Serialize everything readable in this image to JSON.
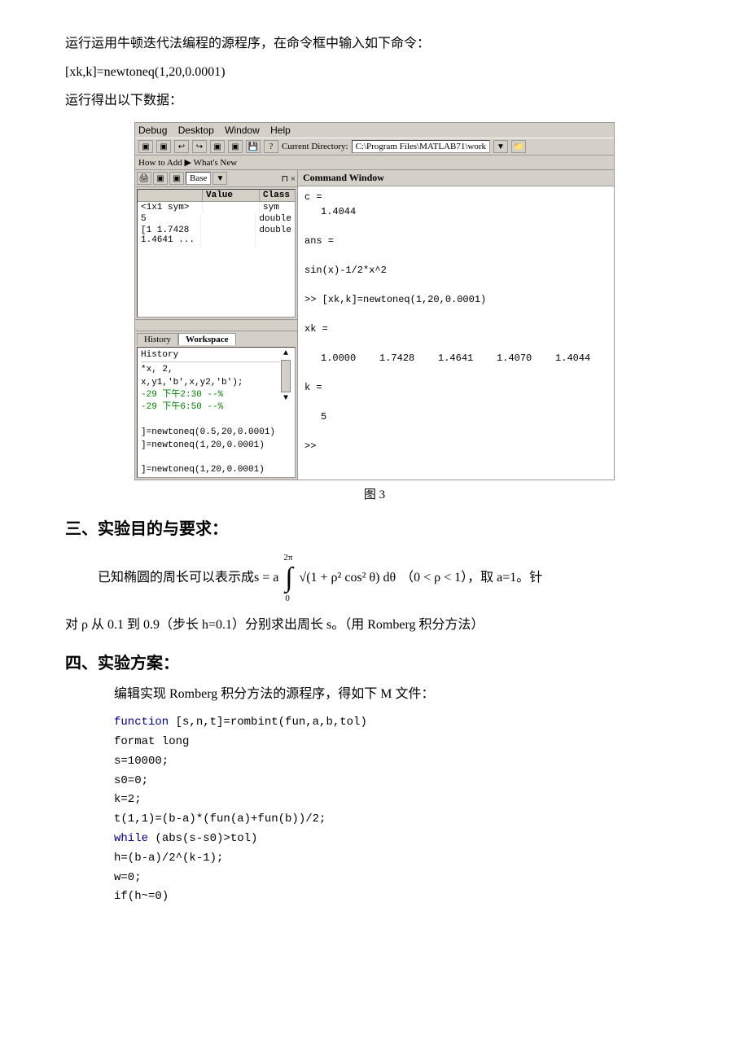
{
  "intro": {
    "line1": "运行运用牛顿迭代法编程的源程序，在命令框中输入如下命令：",
    "line2": "[xk,k]=newtoneq(1,20,0.0001)",
    "line3": "运行得出以下数据："
  },
  "matlab": {
    "menu": [
      "Debug",
      "Desktop",
      "Window",
      "Help"
    ],
    "current_dir_label": "Current Directory:",
    "current_dir_path": "C:\\Program Files\\MATLAB71\\work",
    "howtoadd": "How to Add",
    "whats_new": "What's New",
    "workspace_tab": "Workspace",
    "history_tab": "History",
    "workspace_cols": [
      "",
      "Value",
      "Class"
    ],
    "workspace_rows": [
      {
        "name": "<1x1 sym>",
        "value": "",
        "class": "sym"
      },
      {
        "name": "5",
        "value": "",
        "class": "double"
      },
      {
        "name": "[1 1.7428 1.4641 ...",
        "value": "",
        "class": "double"
      }
    ],
    "history_lines": [
      "*x, 2,",
      "x,y1,'b',x,y2,'b');",
      "-29 下午2:30 --%",
      "-29 下午6:50 --%",
      "",
      "]=newtoneq(0.5,20,0.0001)",
      "]=newtoneq(1,20,0.0001)",
      "",
      "]=newtoneq(1,20,0.0001)"
    ],
    "cmd_window_title": "Command Window",
    "cmd_content": [
      "c =",
      "    1.4044",
      "",
      "ans =",
      "",
      "sin(x)-1/2*x^2",
      "",
      ">> [xk,k]=newtoneq(1,20,0.0001)",
      "",
      "xk =",
      "",
      "    1.0000    1.7428    1.4641    1.4070    1.4044",
      "",
      "k =",
      "",
      "    5",
      "",
      ">>"
    ]
  },
  "fig_caption": "图 3",
  "section3": {
    "heading": "三、实验目的与要求：",
    "formula_prefix": "已知椭圆的周长可以表示成s = a",
    "formula_integral_lower": "0",
    "formula_integral_upper": "2π",
    "formula_integrand": "√(1 + ρ² cos² θ) dθ",
    "formula_condition": "（0 < ρ < 1），取 a=1。针",
    "rho_line": "对 ρ 从 0.1 到 0.9（步长 h=0.1）分别求出周长 s。（用 Romberg 积分方法）"
  },
  "section4": {
    "heading": "四、实验方案：",
    "intro": "编辑实现 Romberg 积分方法的源程序，得如下 M 文件：",
    "code_lines": [
      {
        "text": "function [s,n,t]=rombint(fun,a,b,tol)",
        "keyword_ranges": [
          [
            0,
            8
          ]
        ]
      },
      {
        "text": "format long",
        "keyword_ranges": []
      },
      {
        "text": "s=10000;",
        "keyword_ranges": []
      },
      {
        "text": "s0=0;",
        "keyword_ranges": []
      },
      {
        "text": "k=2;",
        "keyword_ranges": []
      },
      {
        "text": "t(1,1)=(b-a)*(fun(a)+fun(b))/2;",
        "keyword_ranges": []
      },
      {
        "text": "while (abs(s-s0)>tol)",
        "keyword_ranges": [
          [
            0,
            5
          ]
        ]
      },
      {
        "text": "    h=(b-a)/2^(k-1);",
        "keyword_ranges": []
      },
      {
        "text": "    w=0;",
        "keyword_ranges": []
      },
      {
        "text": "    if(h~=0)",
        "keyword_ranges": []
      }
    ]
  }
}
